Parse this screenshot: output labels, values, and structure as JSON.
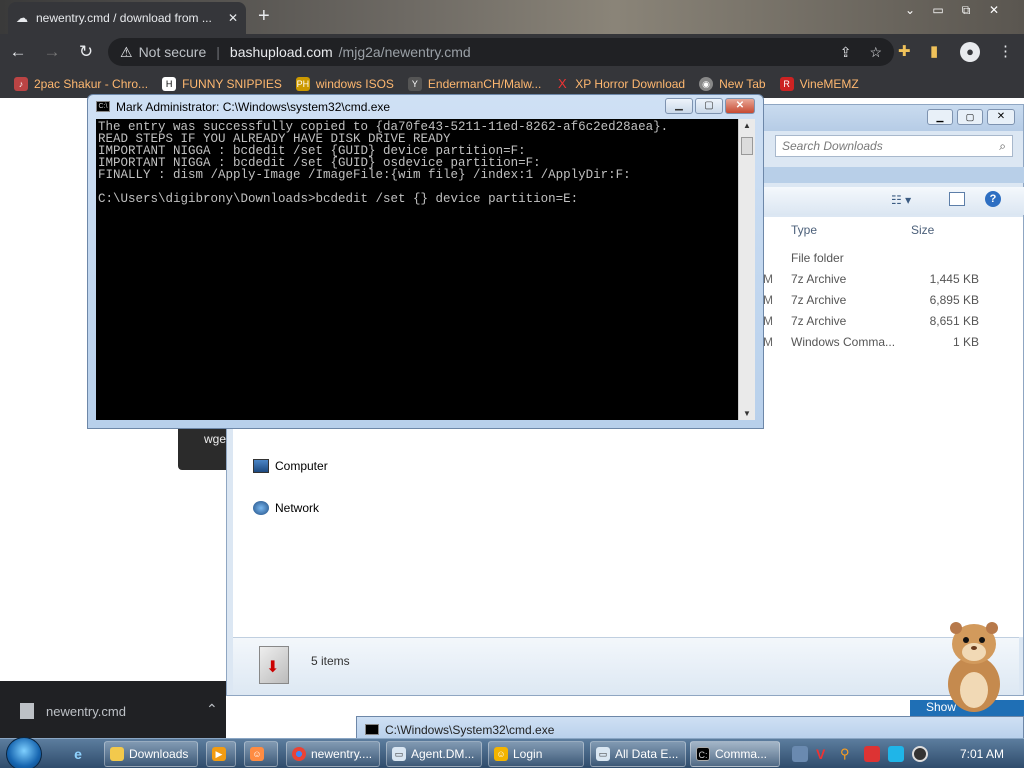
{
  "browser": {
    "tab_title": "newentry.cmd / download from ...",
    "url": {
      "security": "Not secure",
      "domain": "bashupload.com",
      "path": "/mjg2a/newentry.cmd"
    },
    "bookmarks": [
      {
        "label": "2pac Shakur - Chro..."
      },
      {
        "label": "FUNNY SNIPPIES"
      },
      {
        "label": "windows ISOS"
      },
      {
        "label": "EndermanCH/Malw..."
      },
      {
        "label": "XP Horror Download"
      },
      {
        "label": "New Tab"
      },
      {
        "label": "VineMEMZ"
      }
    ],
    "tooltip_text": "wge",
    "download_shelf": {
      "file": "newentry.cmd"
    }
  },
  "explorer": {
    "search_placeholder": "Search Downloads",
    "columns": {
      "type": "Type",
      "size": "Size"
    },
    "files": [
      {
        "m": "",
        "type": "File folder",
        "size": ""
      },
      {
        "m": "M",
        "type": "7z Archive",
        "size": "1,445 KB"
      },
      {
        "m": "M",
        "type": "7z Archive",
        "size": "6,895 KB"
      },
      {
        "m": "M",
        "type": "7z Archive",
        "size": "8,651 KB"
      },
      {
        "m": "M",
        "type": "Windows Comma...",
        "size": "1 KB"
      }
    ],
    "nav": {
      "computer": "Computer",
      "network": "Network"
    },
    "item_count": "5 items"
  },
  "cmd": {
    "title": "Mark Administrator: C:\\Windows\\system32\\cmd.exe",
    "lines": [
      "The entry was successfully copied to {da70fe43-5211-11ed-8262-af6c2ed28aea}.",
      "READ STEPS IF YOU ALREADY HAVE DISK DRIVE READY",
      "IMPORTANT NIGGA : bcdedit /set {GUID} device partition=F:",
      "IMPORTANT NIGGA : bcdedit /set {GUID} osdevice partition=F:",
      "FINALLY : dism /Apply-Image /ImageFile:{wim file} /index:1 /ApplyDir:F:",
      "",
      "C:\\Users\\digibrony\\Downloads>bcdedit /set {} device partition=E:"
    ]
  },
  "background_cmd_title": "C:\\Windows\\System32\\cmd.exe",
  "show_tag": "Show",
  "taskbar": {
    "items": [
      {
        "label": "Downloads"
      },
      {
        "label": "newentry...."
      },
      {
        "label": "Agent.DM..."
      },
      {
        "label": "Login"
      },
      {
        "label": "All Data E..."
      },
      {
        "label": "Comma..."
      }
    ],
    "clock": "7:01 AM"
  }
}
